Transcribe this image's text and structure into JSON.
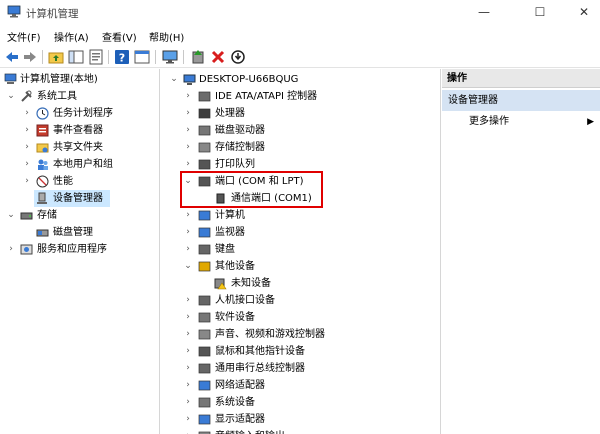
{
  "window": {
    "title": "计算机管理",
    "minimize": "—",
    "maximize": "☐",
    "close": "✕"
  },
  "menu": [
    {
      "label": "文件(F)"
    },
    {
      "label": "操作(A)"
    },
    {
      "label": "查看(V)"
    },
    {
      "label": "帮助(H)"
    }
  ],
  "toolbar": {
    "icons": [
      "back-icon",
      "forward-icon",
      "up-folder-icon",
      "show-hide-tree-icon",
      "properties-icon",
      "help-icon",
      "export-icon",
      "monitor-icon",
      "update-driver-icon",
      "uninstall-icon",
      "disable-icon"
    ]
  },
  "left_tree": {
    "root": "计算机管理(本地)",
    "system_tools": "系统工具",
    "items": [
      "任务计划程序",
      "事件查看器",
      "共享文件夹",
      "本地用户和组",
      "性能",
      "设备管理器"
    ],
    "storage": "存储",
    "disk_mgmt": "磁盘管理",
    "services": "服务和应用程序"
  },
  "device_tree": {
    "root": "DESKTOP-U66BQUG",
    "categories": [
      "IDE ATA/ATAPI 控制器",
      "处理器",
      "磁盘驱动器",
      "存储控制器",
      "打印队列",
      "端口 (COM 和 LPT)",
      "计算机",
      "监视器",
      "键盘",
      "其他设备",
      "人机接口设备",
      "软件设备",
      "声音、视频和游戏控制器",
      "鼠标和其他指针设备",
      "通用串行总线控制器",
      "网络适配器",
      "系统设备",
      "显示适配器",
      "音频输入和输出"
    ],
    "port_child": "通信端口 (COM1)",
    "other_child": "未知设备"
  },
  "actions": {
    "header": "操作",
    "section": "设备管理器",
    "more": "更多操作"
  },
  "colors": {
    "selection": "#cce8ff",
    "highlight": "#e00000",
    "actions_sub": "#d5e3f3"
  }
}
